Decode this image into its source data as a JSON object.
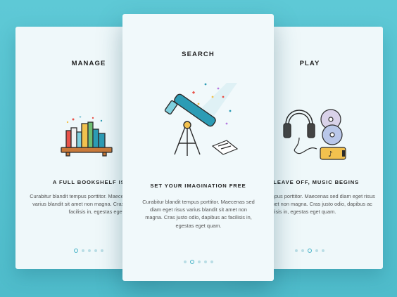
{
  "cards": {
    "left": {
      "title": "MANAGE",
      "headline": "A FULL BOOKSHELF IS A MAGICAL",
      "body": "Curabitur blandit tempus porttitor. Maecenas sed diam eget risus varius blandit sit amet non magna. Cras justo odio, dapibus ac facilisis in, egestas eget quam.",
      "pagination": {
        "count": 5,
        "active": 1
      }
    },
    "center": {
      "title": "SEARCH",
      "headline": "SET YOUR IMAGINATION FREE",
      "body": "Curabitur blandit tempus porttitor. Maecenas sed diam eget risus varius blandit sit amet non magna. Cras justo odio, dapibus ac facilisis in, egestas eget quam.",
      "pagination": {
        "count": 5,
        "active": 2
      }
    },
    "right": {
      "title": "PLAY",
      "headline": "WHERE WORDS LEAVE OFF, MUSIC BEGINS",
      "body": "Curabitur blandit tempus porttitor. Maecenas sed diam eget risus varius blandit sit amet non magna. Cras justo odio, dapibus ac facilisis in, egestas eget quam.",
      "pagination": {
        "count": 5,
        "active": 3
      }
    }
  },
  "icons": [
    "bookshelf-icon",
    "telescope-icon",
    "headphones-icon",
    "cd-icon",
    "music-player-icon"
  ],
  "colors": {
    "background": "#56c2d0",
    "card": "#eff8fa",
    "accent": "#47b3c7",
    "text": "#222222"
  }
}
